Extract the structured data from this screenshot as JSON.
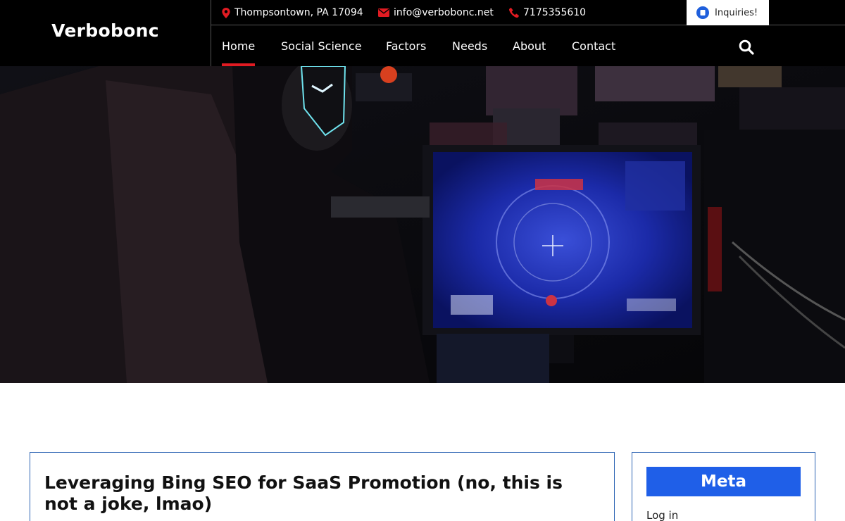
{
  "site": {
    "name": "Verbobonc"
  },
  "topbar": {
    "address": "Thompsontown, PA 17094",
    "email": "info@verbobonc.net",
    "phone": "7175355610",
    "inquiries_label": "Inquiries!"
  },
  "nav": {
    "items": [
      {
        "label": "Home",
        "active": true
      },
      {
        "label": "Social Science"
      },
      {
        "label": "Factors"
      },
      {
        "label": "Needs"
      },
      {
        "label": "About"
      },
      {
        "label": "Contact"
      }
    ]
  },
  "post": {
    "title": "Leveraging Bing SEO for SaaS Promotion (no, this is not a joke, lmao)"
  },
  "sidebar": {
    "widget_title": "Meta",
    "links": [
      "Log in"
    ]
  },
  "colors": {
    "accent_red": "#e11b22",
    "accent_blue": "#1f5fe8",
    "header_bg": "#000000"
  }
}
